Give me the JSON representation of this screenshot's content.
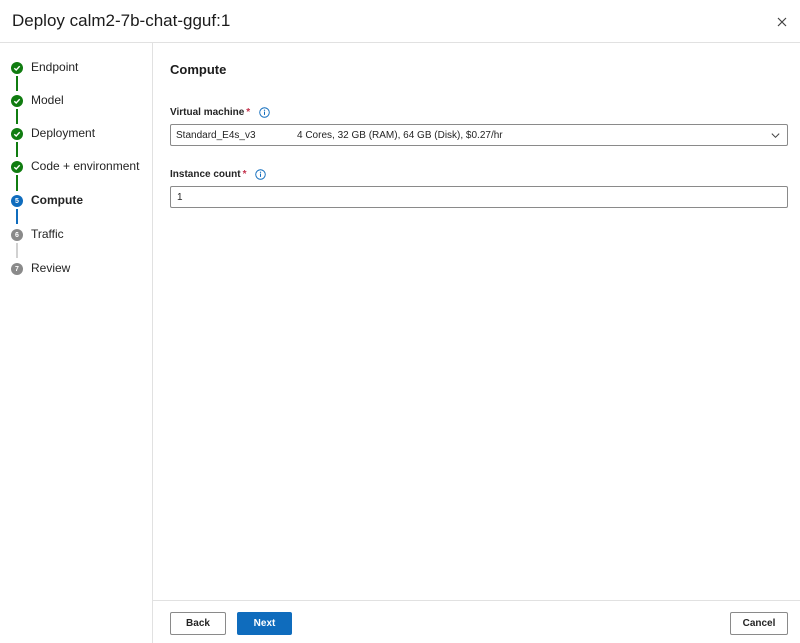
{
  "dialog": {
    "title": "Deploy calm2-7b-chat-gguf:1"
  },
  "steps": [
    {
      "label": "Endpoint",
      "state": "done"
    },
    {
      "label": "Model",
      "state": "done"
    },
    {
      "label": "Deployment",
      "state": "done"
    },
    {
      "label": "Code + environment",
      "state": "done"
    },
    {
      "label": "Compute",
      "state": "active",
      "number": "5"
    },
    {
      "label": "Traffic",
      "state": "pending",
      "number": "6"
    },
    {
      "label": "Review",
      "state": "pending",
      "number": "7"
    }
  ],
  "main": {
    "section_title": "Compute",
    "vm": {
      "label": "Virtual machine",
      "required_mark": "*",
      "sku": "Standard_E4s_v3",
      "spec": "4 Cores, 32 GB (RAM), 64 GB (Disk), $0.27/hr"
    },
    "instance": {
      "label": "Instance count",
      "required_mark": "*",
      "value": "1"
    }
  },
  "footer": {
    "back_label": "Back",
    "next_label": "Next",
    "cancel_label": "Cancel"
  },
  "colors": {
    "accent": "#0f6cbd",
    "success": "#107c10",
    "pending": "#8a8a8a",
    "required": "#c4314b"
  },
  "icons": {
    "close": "close-icon",
    "done": "checkmark-icon",
    "info": "info-icon",
    "dropdown": "chevron-down-icon"
  }
}
